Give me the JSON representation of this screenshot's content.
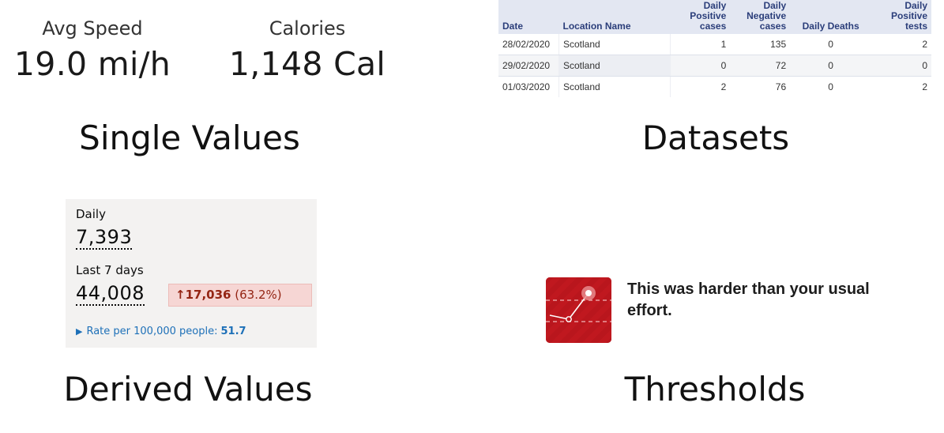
{
  "single_values": {
    "caption": "Single Values",
    "stats": [
      {
        "label": "Avg Speed",
        "value": "19.0 mi/h"
      },
      {
        "label": "Calories",
        "value": "1,148 Cal"
      }
    ]
  },
  "datasets": {
    "caption": "Datasets",
    "columns": [
      "Date",
      "Location Name",
      "Daily Positive cases",
      "Daily Negative cases",
      "Daily Deaths",
      "Daily Positive tests"
    ],
    "rows": [
      [
        "28/02/2020",
        "Scotland",
        "1",
        "135",
        "0",
        "2"
      ],
      [
        "29/02/2020",
        "Scotland",
        "0",
        "72",
        "0",
        "0"
      ],
      [
        "01/03/2020",
        "Scotland",
        "2",
        "76",
        "0",
        "2"
      ]
    ]
  },
  "derived_values": {
    "caption": "Derived Values",
    "daily_label": "Daily",
    "daily_value": "7,393",
    "week_label": "Last 7 days",
    "week_value": "44,008",
    "change_arrow": "↑",
    "change_amount": "17,036",
    "change_percent": "(63.2%)",
    "rate_label": "Rate per 100,000 people:",
    "rate_value": "51.7"
  },
  "thresholds": {
    "caption": "Thresholds",
    "message": "This was harder than your usual effort.",
    "icon_name": "effort-trend-icon"
  },
  "colors": {
    "table_header_bg": "#e3e7f2",
    "table_header_text": "#2b3e7a",
    "change_bg": "#f6d6d4",
    "change_text": "#942514",
    "link_blue": "#1d70b8",
    "threshold_red": "#c0181f"
  }
}
